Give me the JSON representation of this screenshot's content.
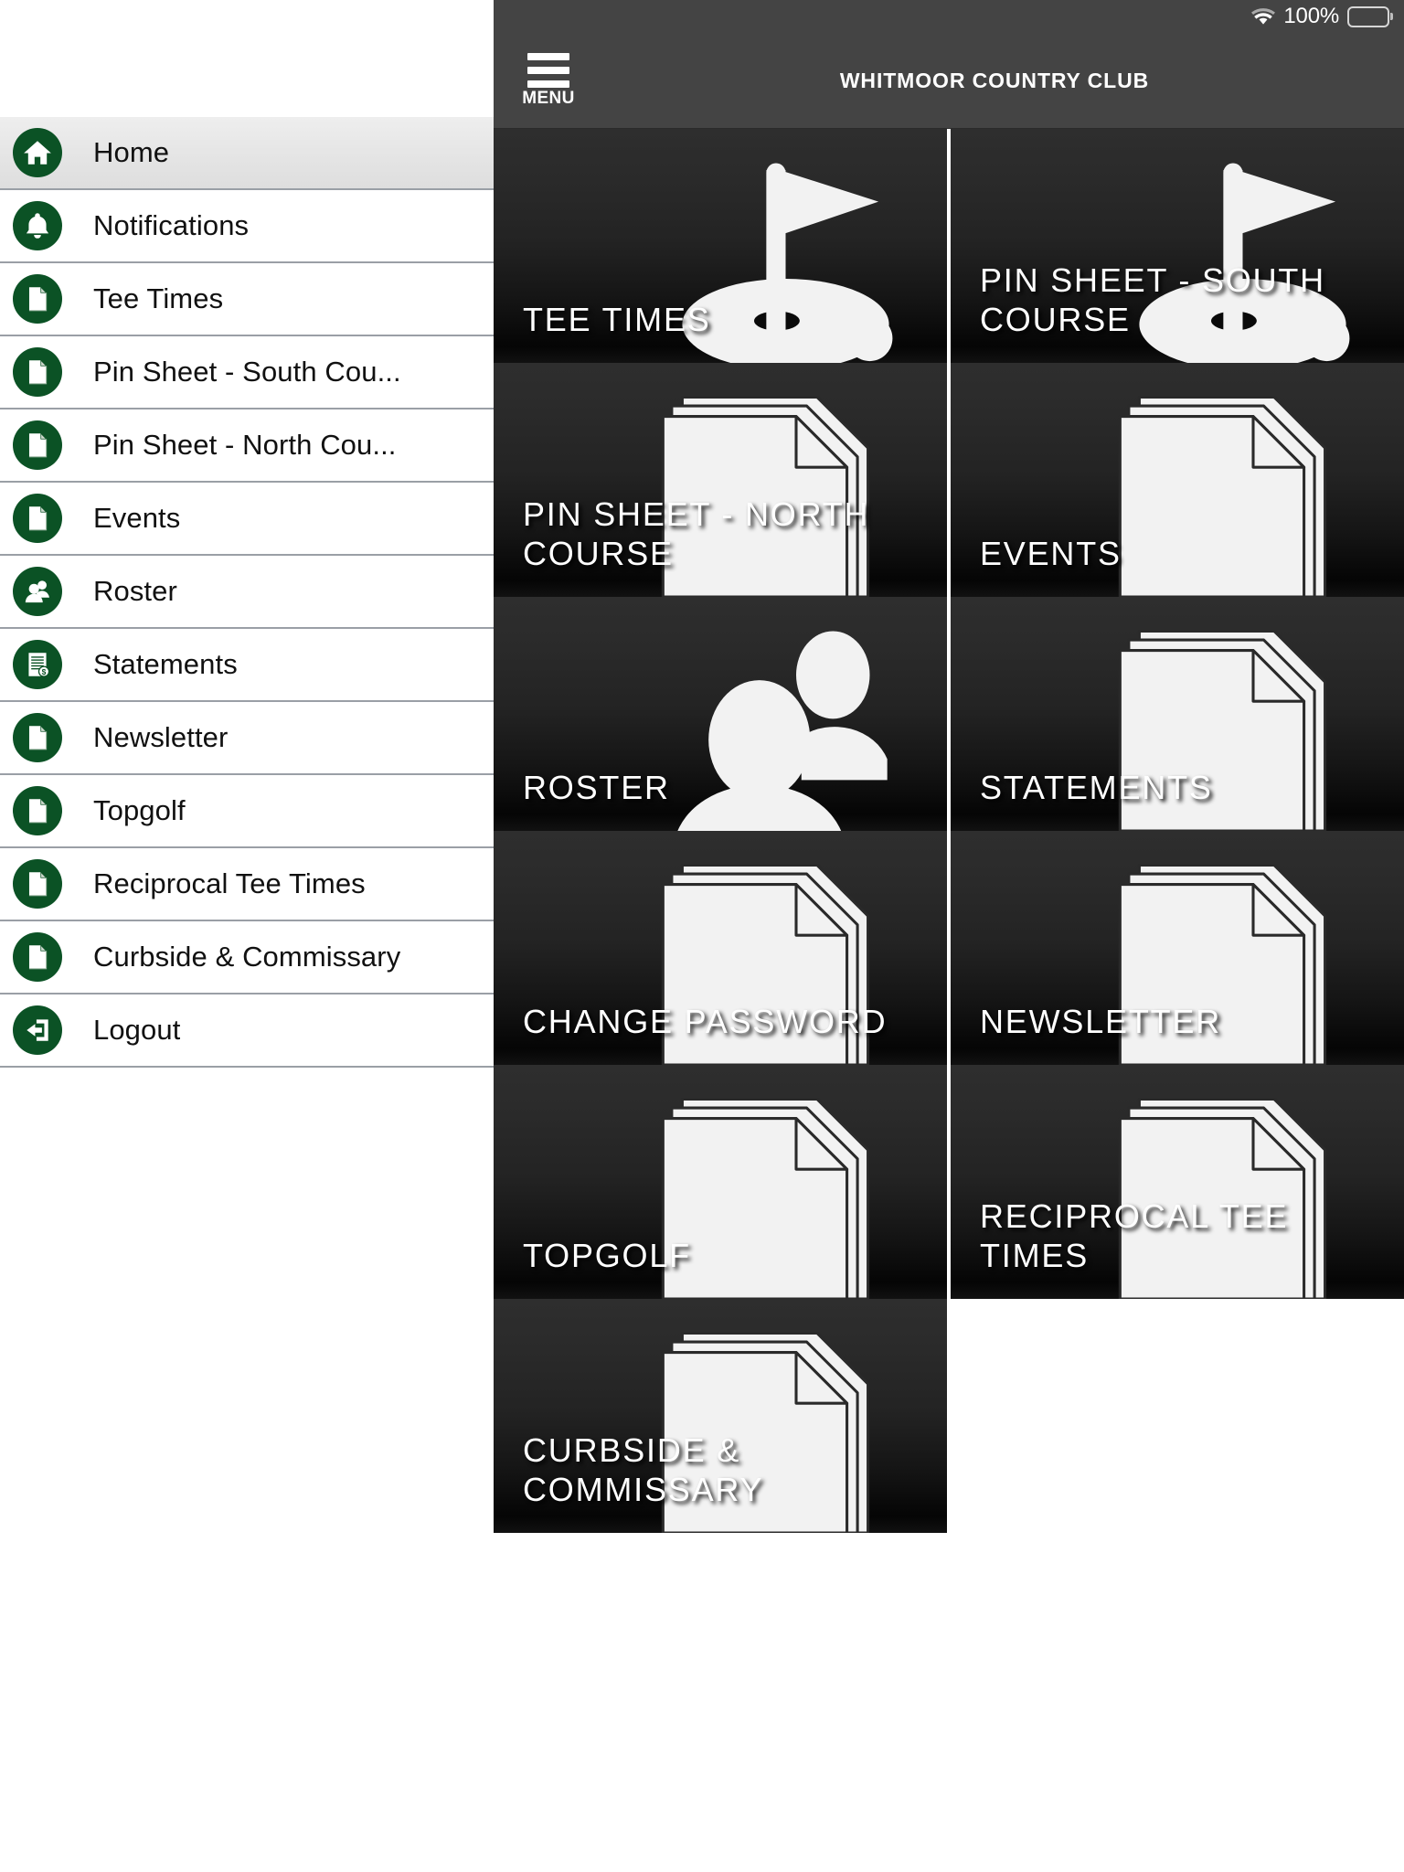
{
  "status_bar": {
    "wifi_icon": "wifi-icon",
    "battery_percent": "100%",
    "battery_icon": "battery-full-icon"
  },
  "header": {
    "menu_icon": "hamburger-menu-icon",
    "menu_label": "MENU",
    "title": "WHITMOOR COUNTRY CLUB"
  },
  "colors": {
    "header_background": "#444444",
    "tile_background_top": "#2e2e2e",
    "tile_background_bottom": "#050505",
    "drawer_icon_green": "#0b5225",
    "drawer_divider": "#9a9fa6",
    "drawer_active": "#e4e4e4"
  },
  "drawer": {
    "items": [
      {
        "label": "Home",
        "icon": "home-icon",
        "active": true
      },
      {
        "label": "Notifications",
        "icon": "bell-icon",
        "active": false
      },
      {
        "label": "Tee Times",
        "icon": "document-icon",
        "active": false
      },
      {
        "label": "Pin Sheet - South Cou...",
        "icon": "document-icon",
        "active": false
      },
      {
        "label": "Pin Sheet - North Cou...",
        "icon": "document-icon",
        "active": false
      },
      {
        "label": "Events",
        "icon": "document-icon",
        "active": false
      },
      {
        "label": "Roster",
        "icon": "people-icon",
        "active": false
      },
      {
        "label": "Statements",
        "icon": "statement-dollar-icon",
        "active": false
      },
      {
        "label": "Newsletter",
        "icon": "document-icon",
        "active": false
      },
      {
        "label": "Topgolf",
        "icon": "document-icon",
        "active": false
      },
      {
        "label": "Reciprocal Tee Times",
        "icon": "document-icon",
        "active": false
      },
      {
        "label": "Curbside & Commissary",
        "icon": "document-icon",
        "active": false
      },
      {
        "label": "Logout",
        "icon": "logout-arrow-icon",
        "active": false
      }
    ]
  },
  "tiles": [
    {
      "label": "TEE TIMES",
      "art": "golf-flag-icon"
    },
    {
      "label": "PIN SHEET - SOUTH COURSE",
      "art": "golf-flag-icon"
    },
    {
      "label": "PIN SHEET - NORTH COURSE",
      "art": "document-icon"
    },
    {
      "label": "EVENTS",
      "art": "document-icon"
    },
    {
      "label": "ROSTER",
      "art": "people-icon"
    },
    {
      "label": "STATEMENTS",
      "art": "document-icon"
    },
    {
      "label": "CHANGE PASSWORD",
      "art": "document-icon"
    },
    {
      "label": "NEWSLETTER",
      "art": "document-icon"
    },
    {
      "label": "TOPGOLF",
      "art": "document-icon"
    },
    {
      "label": "RECIPROCAL TEE TIMES",
      "art": "document-icon"
    },
    {
      "label": "CURBSIDE & COMMISSARY",
      "art": "document-icon"
    }
  ]
}
